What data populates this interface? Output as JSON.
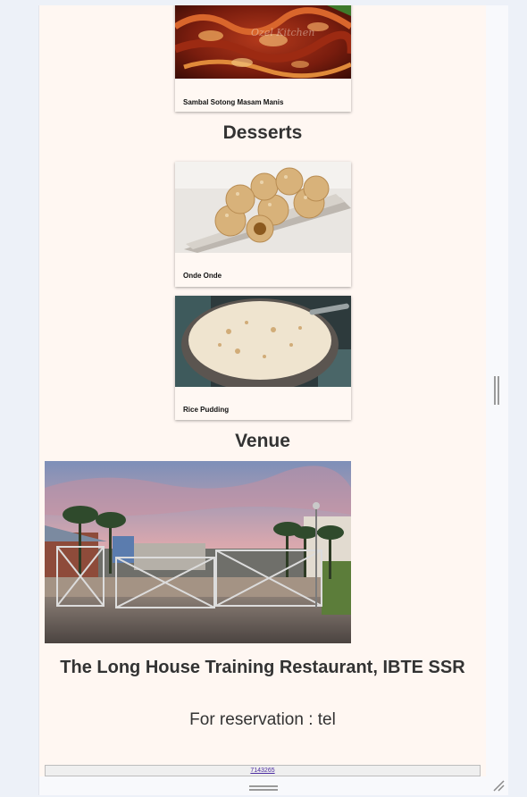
{
  "mains": {
    "last_item": {
      "name": "Sambal Sotong Masam Manis",
      "watermark": "Ozel Kitchen"
    }
  },
  "desserts": {
    "heading": "Desserts",
    "items": [
      {
        "name": "Onde Onde"
      },
      {
        "name": "Rice Pudding"
      }
    ]
  },
  "venue": {
    "heading": "Venue",
    "name": "The Long House Training Restaurant, IBTE SSR",
    "reservation_text": "For reservation : tel",
    "phone": "7143265"
  },
  "colors": {
    "page_bg": "#fff7f2",
    "outer_bg": "#edf1f8",
    "heading": "#333333",
    "link": "#4a2aa0"
  }
}
